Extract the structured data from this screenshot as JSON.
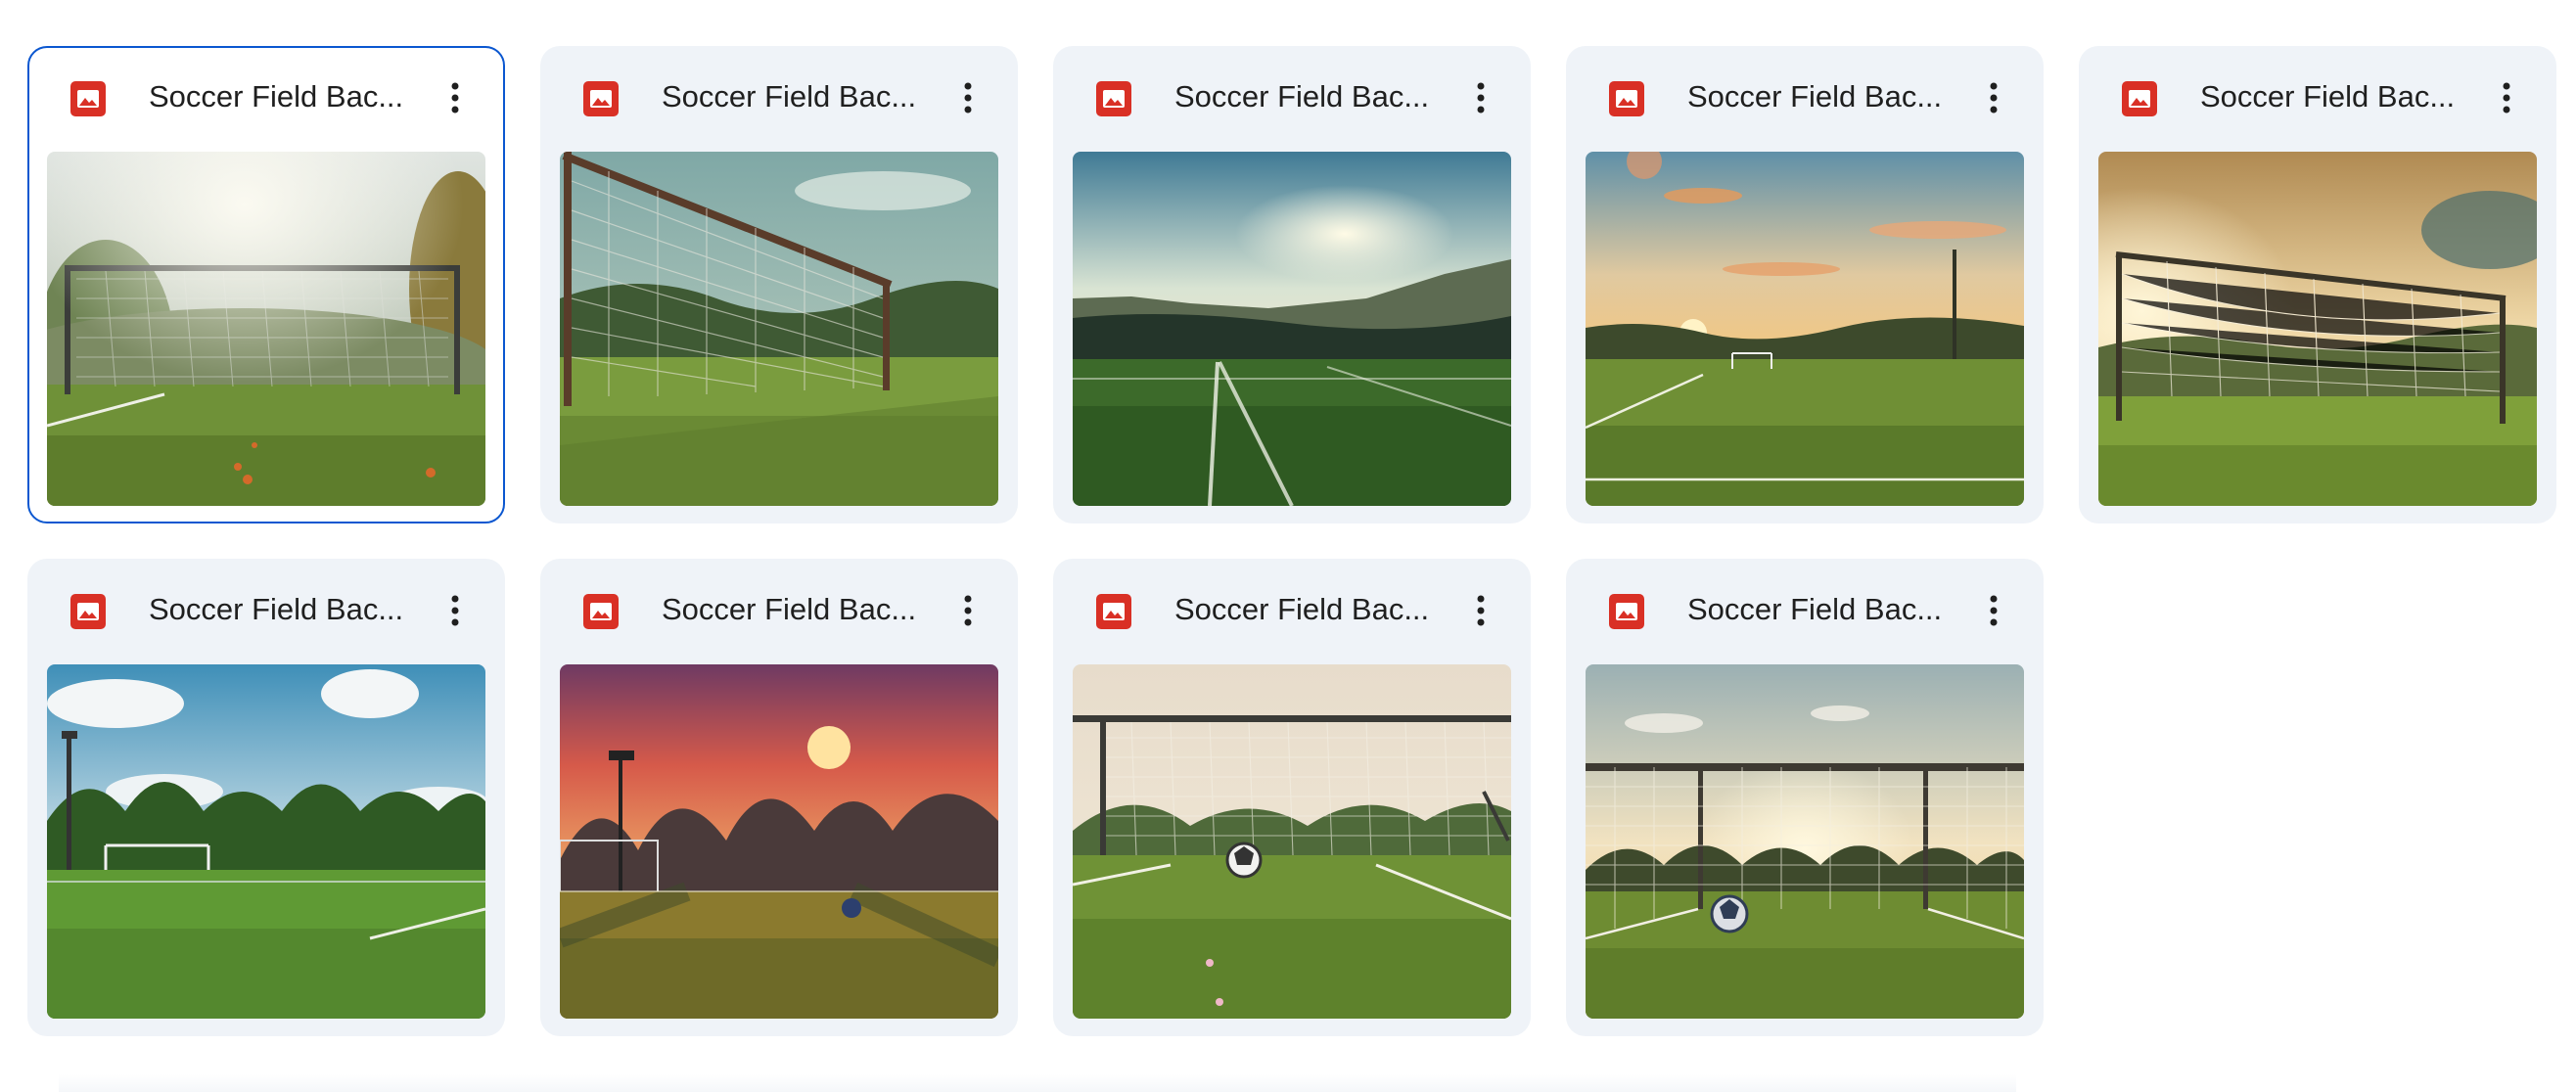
{
  "colors": {
    "card_bg": "#eff3f8",
    "selected_border": "#0b57d0",
    "image_icon": "#d93025",
    "text": "#1f1f1f"
  },
  "files": [
    {
      "name": "Soccer Field Bac...",
      "icon": "image-file-icon",
      "selected": true,
      "scene": "goal-hazy-trees"
    },
    {
      "name": "Soccer Field Bac...",
      "icon": "image-file-icon",
      "selected": false,
      "scene": "goal-net-closeup"
    },
    {
      "name": "Soccer Field Bac...",
      "icon": "image-file-icon",
      "selected": false,
      "scene": "field-sunset-hills"
    },
    {
      "name": "Soccer Field Bac...",
      "icon": "image-file-icon",
      "selected": false,
      "scene": "field-golden-sky"
    },
    {
      "name": "Soccer Field Bac...",
      "icon": "image-file-icon",
      "selected": false,
      "scene": "goal-golden-light"
    },
    {
      "name": "Soccer Field Bac...",
      "icon": "image-file-icon",
      "selected": false,
      "scene": "field-blue-sky"
    },
    {
      "name": "Soccer Field Bac...",
      "icon": "image-file-icon",
      "selected": false,
      "scene": "field-red-sky-ball"
    },
    {
      "name": "Soccer Field Bac...",
      "icon": "image-file-icon",
      "selected": false,
      "scene": "goal-ball-grass"
    },
    {
      "name": "Soccer Field Bac...",
      "icon": "image-file-icon",
      "selected": false,
      "scene": "goal-sunset-ball"
    }
  ]
}
